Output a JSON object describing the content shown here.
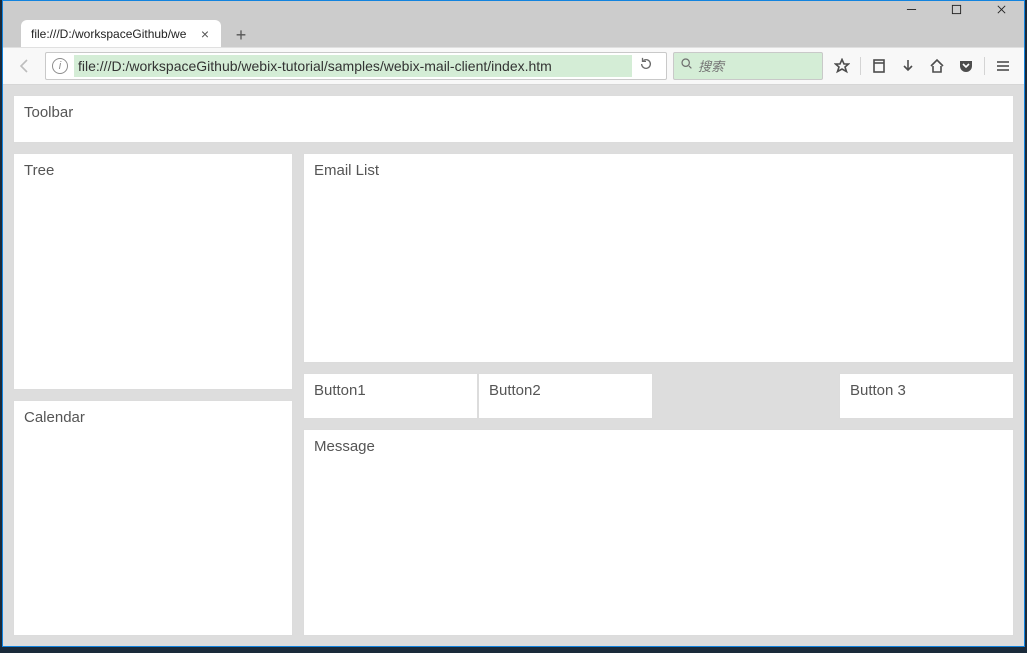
{
  "browser": {
    "tab": {
      "title": "file:///D:/workspaceGithub/we"
    },
    "address": "file:///D:/workspaceGithub/webix-tutorial/samples/webix-mail-client/index.htm",
    "search_placeholder": "搜索"
  },
  "page": {
    "toolbar": "Toolbar",
    "tree": "Tree",
    "calendar": "Calendar",
    "email_list": "Email List",
    "buttons": {
      "b1": "Button1",
      "b2": "Button2",
      "b3": "Button 3"
    },
    "message": "Message"
  }
}
